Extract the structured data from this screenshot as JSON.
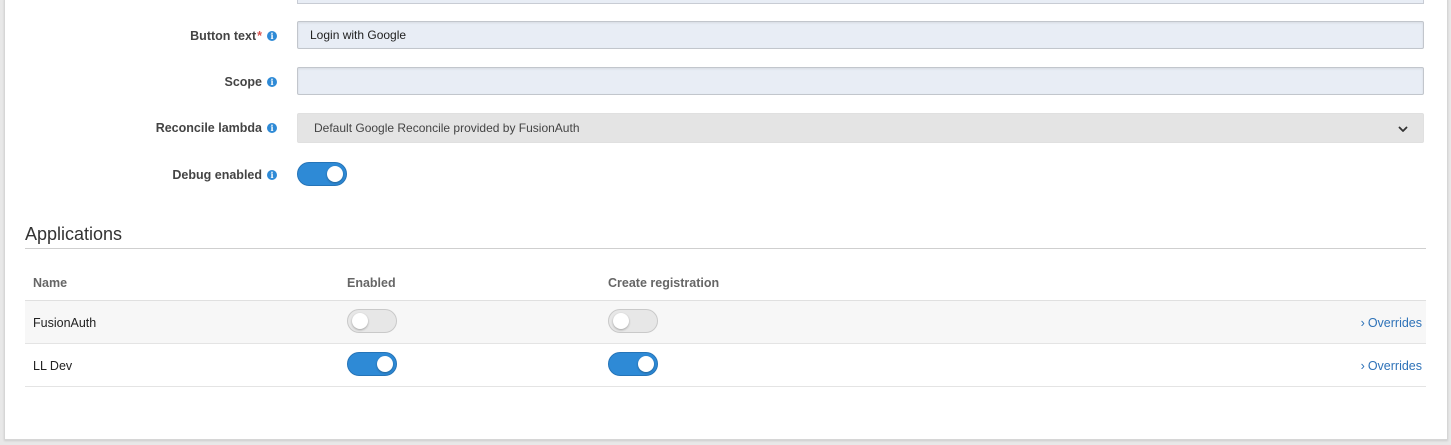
{
  "form": {
    "button_text": {
      "label": "Button text",
      "required_mark": "*",
      "value": "Login with Google"
    },
    "scope": {
      "label": "Scope",
      "value": ""
    },
    "reconcile_lambda": {
      "label": "Reconcile lambda",
      "selected": "Default Google Reconcile provided by FusionAuth"
    },
    "debug_enabled": {
      "label": "Debug enabled",
      "on": true
    }
  },
  "applications": {
    "title": "Applications",
    "columns": {
      "name": "Name",
      "enabled": "Enabled",
      "create_registration": "Create registration"
    },
    "rows": [
      {
        "name": "FusionAuth",
        "enabled": false,
        "create_registration": false,
        "action": "Overrides"
      },
      {
        "name": "LL Dev",
        "enabled": true,
        "create_registration": true,
        "action": "Overrides"
      }
    ]
  },
  "icons": {
    "info": "info-icon",
    "chevron_down": "chevron-down-icon",
    "chevron_right": "chevron-right-icon"
  },
  "colors": {
    "accent": "#2e8ad6",
    "link": "#2e72b8",
    "required": "#d9534f"
  }
}
